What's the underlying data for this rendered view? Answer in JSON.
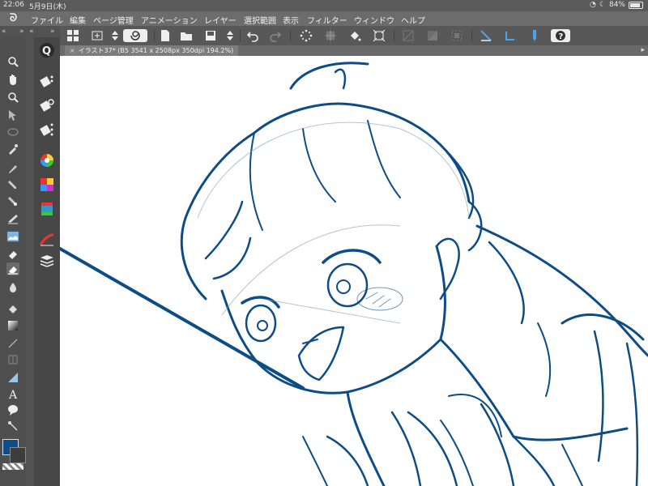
{
  "status": {
    "time": "22:06",
    "date": "5月9日(木)",
    "battery": "84%",
    "battery_level": 0.84
  },
  "menu": {
    "items": [
      "ファイル",
      "編集",
      "ページ管理",
      "アニメーション",
      "レイヤー",
      "選択範囲",
      "表示",
      "フィルター",
      "ウィンドウ",
      "ヘルプ"
    ]
  },
  "tab": {
    "title": "イラスト37* (B5 3541 x 2508px 350dpi 194.2%)",
    "close": "×"
  },
  "colors": {
    "main": "#0d4c86",
    "sub": "#3d3d3d",
    "stroke": "#0d4c86"
  },
  "toolbar_icons": [
    "grid-icon",
    "layer-transform-icon",
    "swirl-icon",
    "new-file-icon",
    "open-folder-icon",
    "save-icon",
    "undo-icon",
    "redo-icon",
    "loading-icon",
    "transform-icon",
    "fill-icon",
    "select-all-icon",
    "ruler-icon",
    "pen-pressure-icon",
    "help-icon"
  ],
  "tools": [
    "zoom-icon",
    "hand-icon",
    "rotate-icon",
    "move-icon",
    "lasso-icon",
    "eyedropper-icon",
    "pen-icon",
    "pencil-icon",
    "brush-icon",
    "airbrush-icon",
    "decoration-icon",
    "eraser-icon",
    "blend-icon",
    "fill-bucket-icon",
    "gradient-icon",
    "line-icon",
    "frame-icon",
    "ruler-tool-icon",
    "text-icon",
    "balloon-icon",
    "correction-icon"
  ]
}
